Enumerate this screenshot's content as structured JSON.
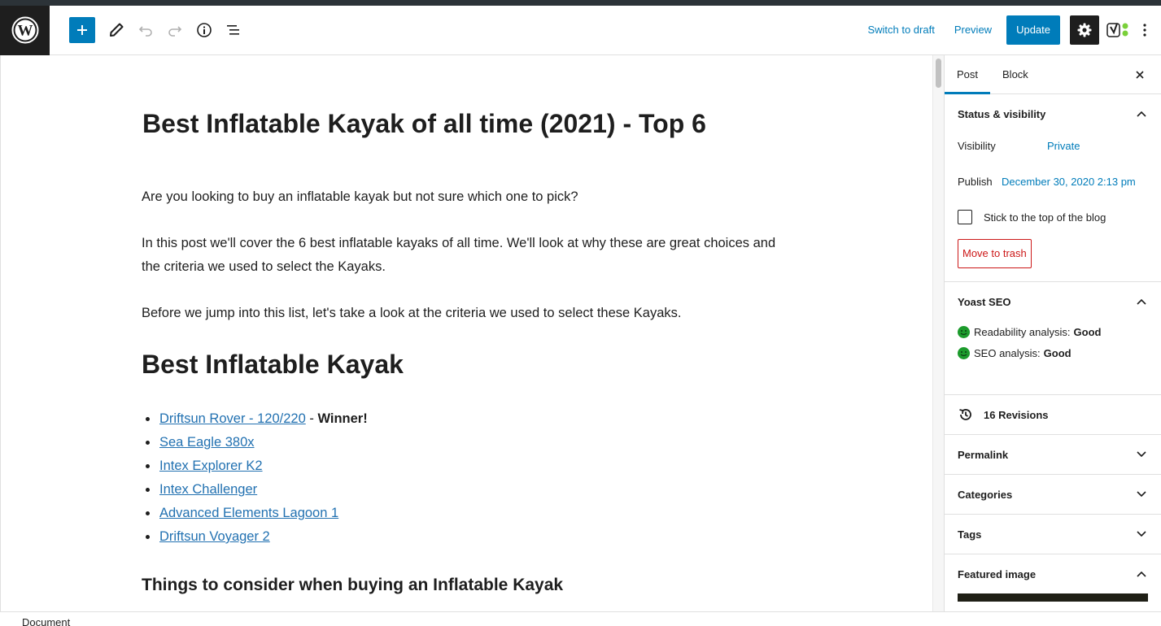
{
  "header": {
    "switch_to_draft": "Switch to draft",
    "preview": "Preview",
    "update": "Update"
  },
  "post": {
    "title": "Best Inflatable Kayak of all time (2021) - Top 6",
    "para1": "Are you looking to buy an inflatable kayak but not sure which one to pick?",
    "para2": "In this post we'll cover the 6 best inflatable kayaks of all time. We'll look at why these are great choices and the criteria we used to select the Kayaks.",
    "para3": "Before we jump into this list, let's take a look at the criteria we used to select these Kayaks.",
    "heading2": "Best Inflatable Kayak",
    "list": [
      {
        "link": "Driftsun Rover - 120/220",
        "suffix": " - ",
        "bold": "Winner!"
      },
      {
        "link": "Sea Eagle 380x"
      },
      {
        "link": "Intex Explorer K2"
      },
      {
        "link": "Intex Challenger"
      },
      {
        "link": "Advanced Elements Lagoon 1"
      },
      {
        "link": "Driftsun Voyager 2"
      }
    ],
    "heading3": "Things to consider when buying an Inflatable Kayak"
  },
  "sidebar": {
    "tab_post": "Post",
    "tab_block": "Block",
    "status_title": "Status & visibility",
    "visibility_label": "Visibility",
    "visibility_value": "Private",
    "publish_label": "Publish",
    "publish_value": "December 30, 2020 2:13 pm",
    "stick_label": "Stick to the top of the blog",
    "trash": "Move to trash",
    "yoast_title": "Yoast SEO",
    "readability_label": "Readability analysis: ",
    "readability_value": "Good",
    "seo_label": "SEO analysis: ",
    "seo_value": "Good",
    "revisions": "16 Revisions",
    "permalink": "Permalink",
    "categories": "Categories",
    "tags": "Tags",
    "featured_image": "Featured image"
  },
  "footer": {
    "breadcrumb": "Document"
  },
  "colors": {
    "accent": "#007cba",
    "danger": "#cc1818",
    "yoast_good": "#1c9b2c",
    "dark": "#1e1e1e"
  }
}
